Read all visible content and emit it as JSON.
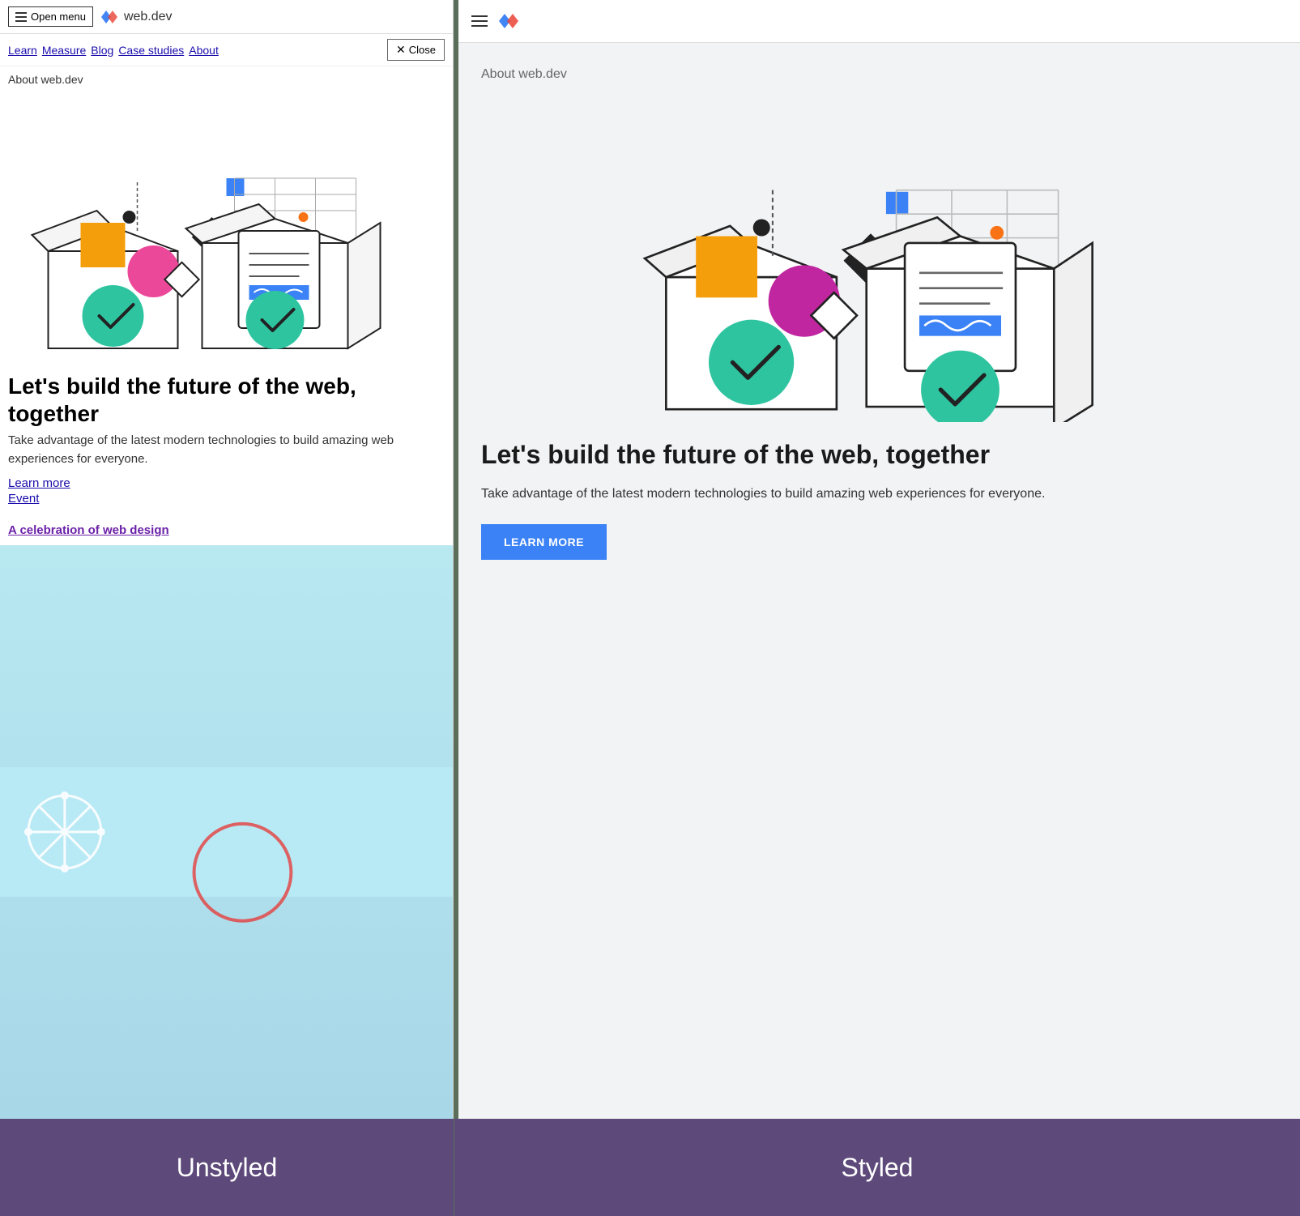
{
  "left": {
    "nav": {
      "menu_btn": "Open menu",
      "logo_text": "web.dev",
      "close_btn": "Close",
      "nav_links": [
        "Learn",
        "Measure",
        "Blog",
        "Case studies",
        "About"
      ]
    },
    "about_label": "About web.dev",
    "hero_heading": "Let's build the future of the web, together",
    "hero_desc": "Take advantage of the latest modern technologies to build amazing web experiences for everyone.",
    "links": [
      "Learn more",
      "Event"
    ],
    "celebration_link": "A celebration of web design"
  },
  "right": {
    "about_label": "About web.dev",
    "hero_heading": "Let's build the future of the web, together",
    "hero_desc": "Take advantage of the latest modern technologies to build amazing web experiences for everyone.",
    "learn_btn": "LEARN MORE"
  },
  "labels": {
    "unstyled": "Unstyled",
    "styled": "Styled"
  },
  "colors": {
    "accent_blue": "#3b82f6",
    "accent_purple": "#6b21a8",
    "teal_check": "#2ec4a0",
    "orange": "#f59e0b",
    "pink": "#ec4899",
    "dark": "#1a1a1a",
    "label_bg": "#5d4a7a"
  }
}
